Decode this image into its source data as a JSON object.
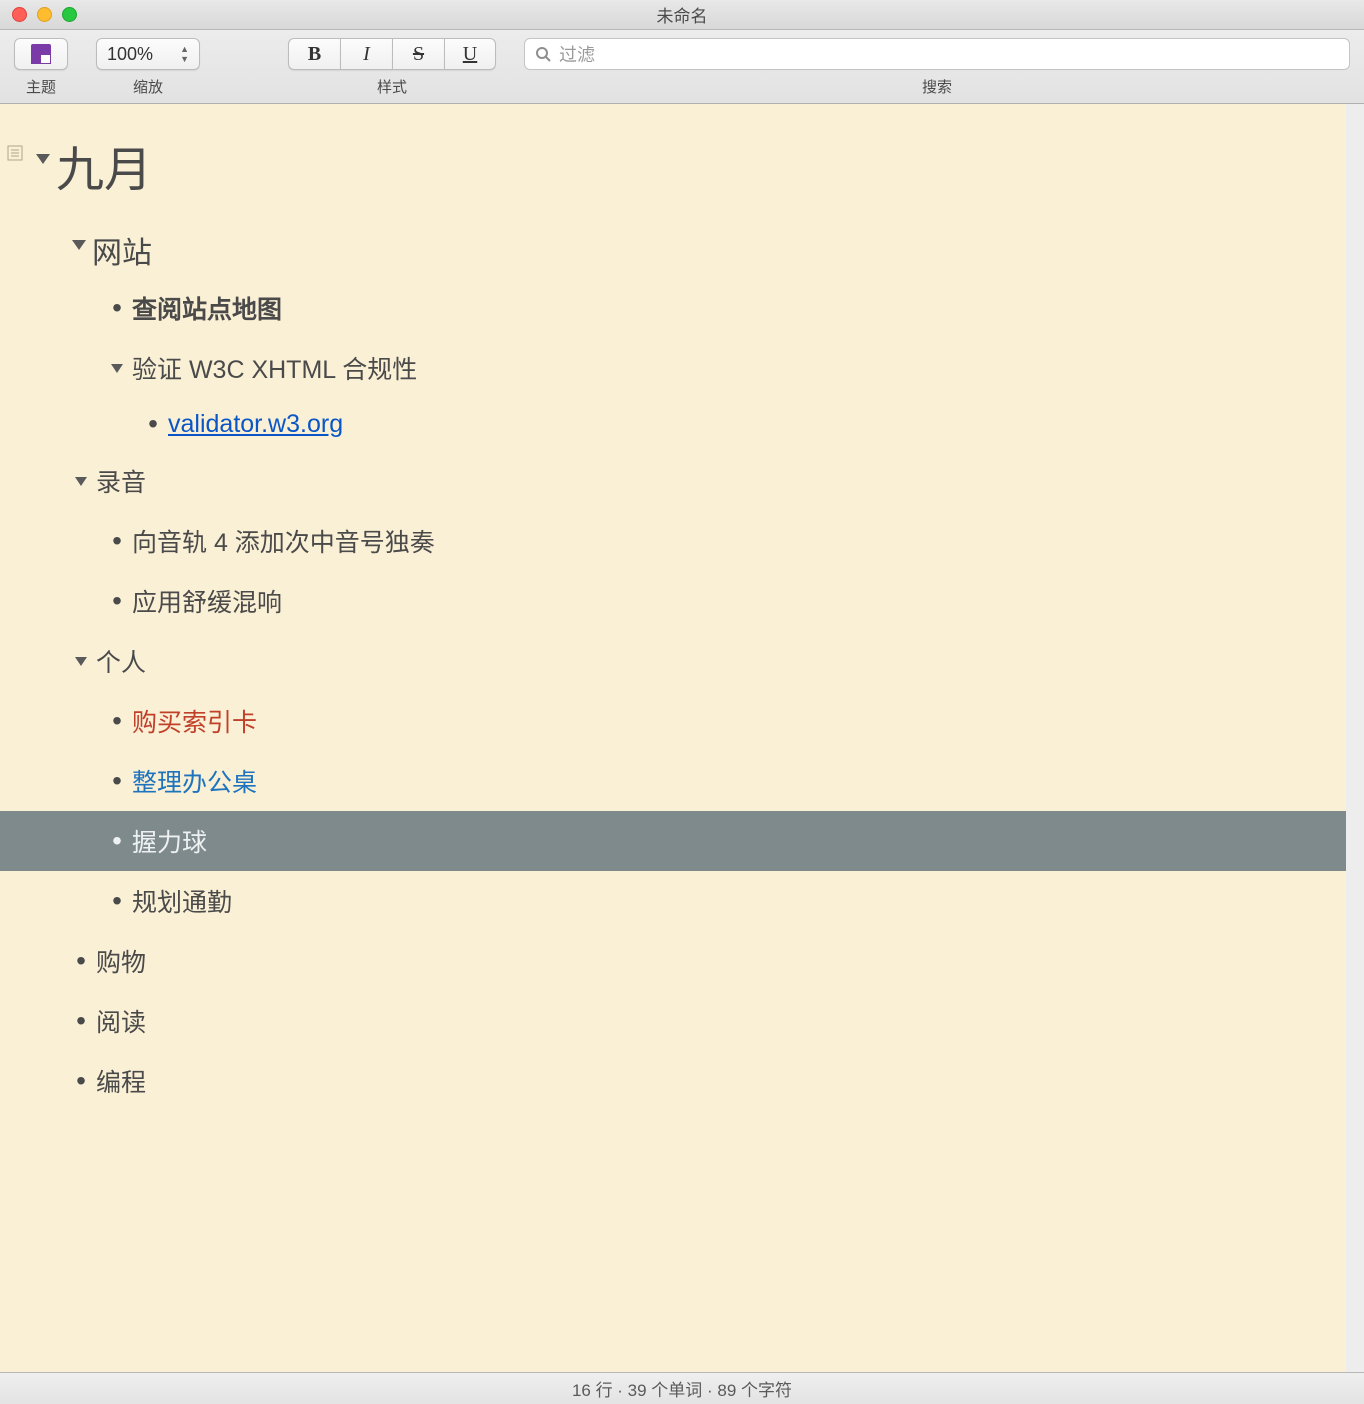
{
  "window": {
    "title": "未命名"
  },
  "toolbar": {
    "theme_label": "主题",
    "zoom_label": "缩放",
    "zoom_value": "100%",
    "style_label": "样式",
    "style_bold": "B",
    "style_italic": "I",
    "style_strike": "S",
    "style_under": "U",
    "search_label": "搜索",
    "search_placeholder": "过滤"
  },
  "outline": {
    "root": "九月",
    "sections": [
      {
        "title": "网站",
        "items": [
          {
            "text": "查阅站点地图",
            "style": "bold"
          },
          {
            "text": "验证 W3C XHTML 合规性",
            "style": "plain",
            "expandable": true,
            "children": [
              {
                "text": "validator.w3.org",
                "style": "link"
              }
            ]
          }
        ]
      },
      {
        "title": "录音",
        "items": [
          {
            "text": "向音轨 4 添加次中音号独奏",
            "style": "plain"
          },
          {
            "text": "应用舒缓混响",
            "style": "plain"
          }
        ]
      },
      {
        "title": "个人",
        "items": [
          {
            "text": "购买索引卡",
            "style": "red"
          },
          {
            "text": "整理办公桌",
            "style": "blue"
          },
          {
            "text": "握力球",
            "style": "plain",
            "highlighted": true
          },
          {
            "text": "规划通勤",
            "style": "plain"
          }
        ]
      },
      {
        "title": "购物",
        "leaf": true
      },
      {
        "title": "阅读",
        "leaf": true
      },
      {
        "title": "编程",
        "leaf": true
      }
    ]
  },
  "status": {
    "text": "16 行 · 39 个单词 · 89 个字符"
  }
}
